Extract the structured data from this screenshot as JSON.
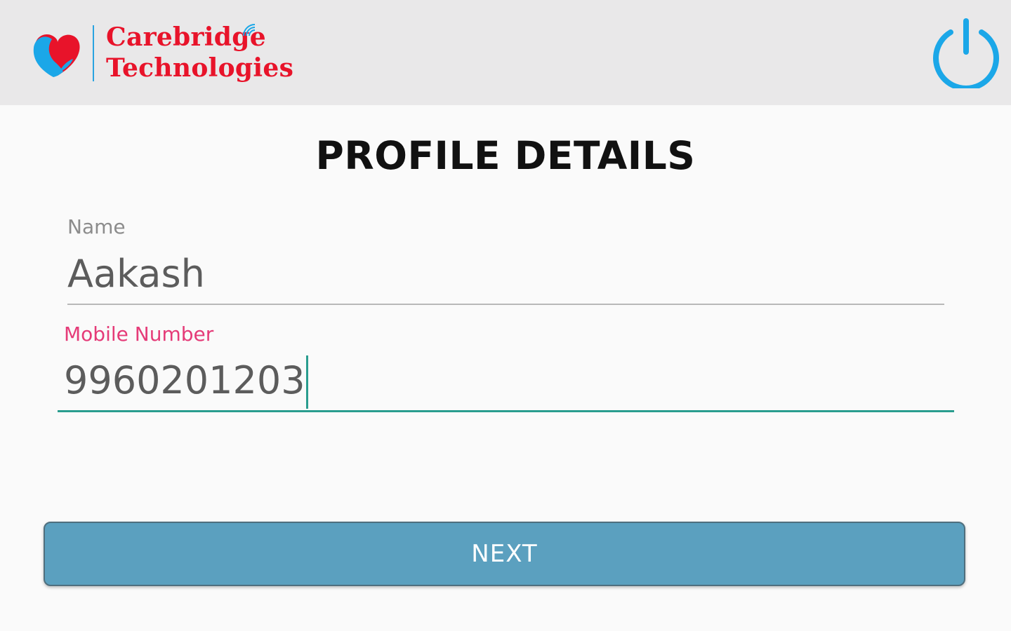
{
  "header": {
    "logo": {
      "line1": "Carebridge",
      "line2": "Technologies",
      "heart_icon": "heart-logo-icon",
      "signal_icon": "wireless-signal-icon"
    },
    "power_icon": "power-icon",
    "accent_color": "#1ba7e8"
  },
  "page": {
    "title": "PROFILE DETAILS"
  },
  "form": {
    "name": {
      "label": "Name",
      "value": "Aakash"
    },
    "mobile": {
      "label": "Mobile Number",
      "value": "9960201203",
      "focused": true
    },
    "next_label": "NEXT"
  },
  "colors": {
    "brand_red": "#e8132a",
    "focus_label": "#e53b78",
    "focus_underline": "#2a9d8f",
    "button_bg": "#5ba0bf"
  }
}
